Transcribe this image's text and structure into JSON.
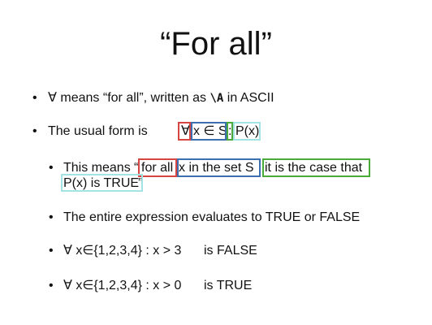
{
  "slide": {
    "title": "“For all”",
    "bullets": [
      {
        "symbol": "∀",
        "pre": " means “for all”, written as ",
        "code": "\\A",
        "post": " in ASCII"
      },
      {
        "label": "The usual form is",
        "quantifier": "∀",
        "variable": "x ∈ S",
        "separator": ":",
        "predicate": "P(x)"
      },
      {
        "open_quote": "“",
        "lead": "This means ",
        "part_forall": "for all",
        "part_set": "x in the set S",
        "comma": ",",
        "part_case": "it is the case that",
        "part_pred": "P(x) is TRUE",
        "close_quote": "”"
      },
      {
        "text": "The entire expression evaluates to TRUE or FALSE"
      },
      {
        "expr": "∀ x∈{1,2,3,4} : x > 3",
        "result": "is FALSE"
      },
      {
        "expr": "∀ x∈{1,2,3,4} : x > 0",
        "result": "is TRUE"
      }
    ]
  },
  "colors": {
    "forall_box": "#d64541",
    "set_box": "#3b6fb0",
    "case_box": "#4caa3a",
    "predicate_box": "#a3e3e3"
  }
}
